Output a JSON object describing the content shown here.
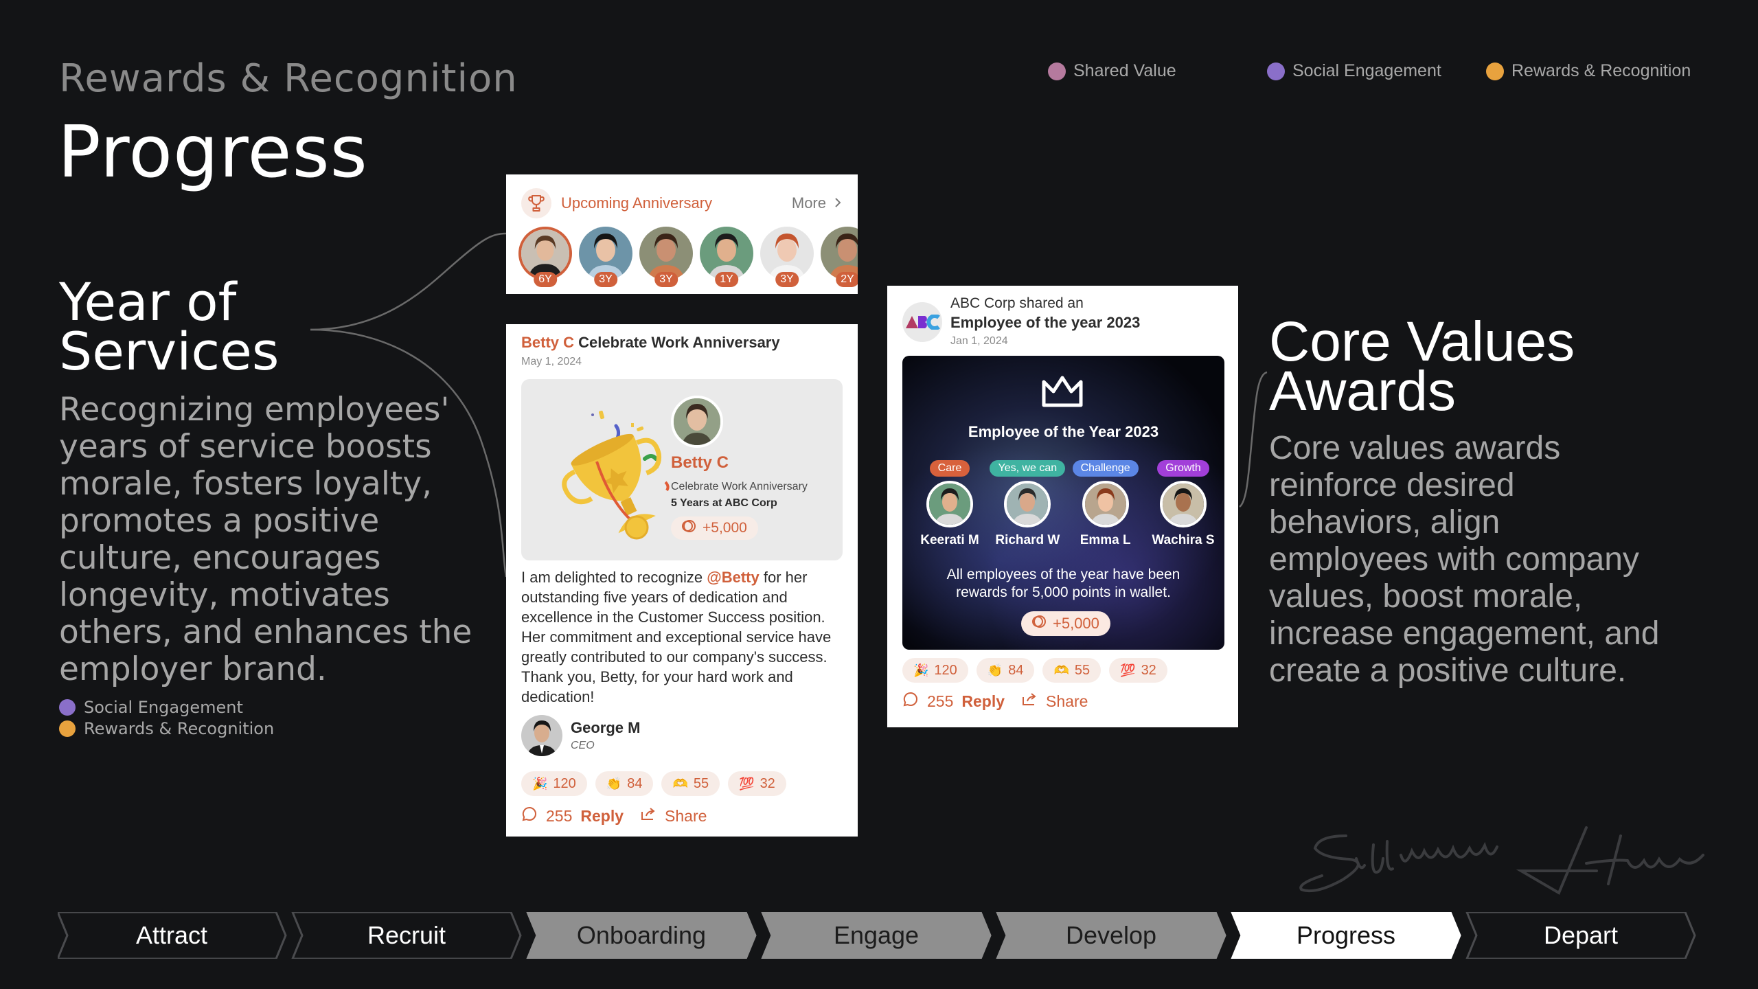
{
  "header": {
    "eyebrow": "Rewards & Recognition",
    "title": "Progress"
  },
  "top_legend": [
    {
      "label": "Shared Value",
      "color": "#b57a9e"
    },
    {
      "label": "Social Engagement",
      "color": "#8a6fc9"
    },
    {
      "label": "Rewards & Recognition",
      "color": "#e8a23e"
    }
  ],
  "left_section": {
    "title_line1": "Year of",
    "title_line2": "Services",
    "body_lines": [
      "Recognizing employees'",
      "years of service boosts",
      "morale, fosters loyalty,",
      "promotes a positive",
      "culture, encourages",
      "longevity, motivates",
      "others, and enhances the",
      "employer brand."
    ],
    "legend": [
      {
        "label": "Social Engagement",
        "color": "#8a6fc9"
      },
      {
        "label": "Rewards & Recognition",
        "color": "#e8a23e"
      }
    ]
  },
  "right_section": {
    "title_line1": "Core Values",
    "title_line2": "Awards",
    "body_lines": [
      "Core values awards",
      "reinforce desired",
      "behaviors, align",
      "employees with company",
      "values, boost morale,",
      "increase engagement, and",
      "create a positive culture."
    ]
  },
  "anniversary_card": {
    "title": "Upcoming Anniversary",
    "more_label": "More",
    "icon": "trophy-icon",
    "people": [
      {
        "years": "6Y",
        "bg": "#c9bfb3",
        "skin": "#e2b99b",
        "hair": "#5a3a24",
        "shirt": "#1e1e1e"
      },
      {
        "years": "3Y",
        "bg": "#6d94a8",
        "skin": "#e9c2a6",
        "hair": "#151515",
        "shirt": "#b9cfe0"
      },
      {
        "years": "3Y",
        "bg": "#8c8f76",
        "skin": "#c99072",
        "hair": "#3a2417",
        "shirt": "#d07b4e"
      },
      {
        "years": "1Y",
        "bg": "#6b9c7d",
        "skin": "#e0b08d",
        "hair": "#1c1c1c",
        "shirt": "#d7d7d7"
      },
      {
        "years": "3Y",
        "bg": "#e5e5e5",
        "skin": "#efc9b3",
        "hair": "#c4552e",
        "shirt": "#f4f4f4"
      },
      {
        "years": "2Y",
        "bg": "#8c8f76",
        "skin": "#c99072",
        "hair": "#3a2417",
        "shirt": "#d07b4e"
      }
    ]
  },
  "anniversary_post": {
    "name": "Betty C",
    "action": "Celebrate Work Anniversary",
    "date": "May 1, 2024",
    "hero": {
      "name": "Betty C",
      "subtitle": "Celebrate Work Anniversary",
      "tenure": "5 Years at ABC Corp",
      "points": "+5,000"
    },
    "message_prefix": "I am delighted to recognize ",
    "mention": "@Betty",
    "message_suffix": " for her outstanding five years of dedication and excellence in the Customer Success position. Her commitment and exceptional service have greatly contributed to our company's success. Thank you, Betty, for your hard work and dedication!",
    "author": {
      "name": "George M",
      "role": "CEO"
    },
    "reactions": [
      {
        "emoji": "🎉",
        "count": "120"
      },
      {
        "emoji": "👏",
        "count": "84"
      },
      {
        "emoji": "🫶",
        "count": "55"
      },
      {
        "emoji": "💯",
        "count": "32"
      }
    ],
    "comments": "255",
    "reply_label": "Reply",
    "share_label": "Share"
  },
  "core_values_post": {
    "company_logo": "ABC",
    "line1": "ABC Corp shared an",
    "line2": "Employee of the year 2023",
    "date": "Jan 1, 2024",
    "banner_title": "Employee of the Year 2023",
    "winners": [
      {
        "tag": "Care",
        "tag_color": "#d8613c",
        "name": "Keerati M",
        "bg": "#6b9c7d",
        "skin": "#e0b08d",
        "hair": "#1c1c1c"
      },
      {
        "tag": "Yes, we can",
        "tag_color": "#3fb3a1",
        "name": "Richard W",
        "bg": "#9fb3b3",
        "skin": "#d9a88a",
        "hair": "#2a2a2a"
      },
      {
        "tag": "Challenge",
        "tag_color": "#5b86e5",
        "name": "Emma L",
        "bg": "#b8a58e",
        "skin": "#efc2a3",
        "hair": "#8a3a1c"
      },
      {
        "tag": "Growth",
        "tag_color": "#a23fd9",
        "name": "Wachira S",
        "bg": "#c8bea8",
        "skin": "#a9724f",
        "hair": "#161616"
      }
    ],
    "banner_text_line1": "All employees of the year have been",
    "banner_text_line2": "rewards for 5,000 points in wallet.",
    "points": "+5,000",
    "reactions": [
      {
        "emoji": "🎉",
        "count": "120"
      },
      {
        "emoji": "👏",
        "count": "84"
      },
      {
        "emoji": "🫶",
        "count": "55"
      },
      {
        "emoji": "💯",
        "count": "32"
      }
    ],
    "comments": "255",
    "reply_label": "Reply",
    "share_label": "Share"
  },
  "signature": "Sittiporng Hans",
  "journey_nav": [
    {
      "label": "Attract",
      "state": "outline"
    },
    {
      "label": "Recruit",
      "state": "outline"
    },
    {
      "label": "Onboarding",
      "state": "gray"
    },
    {
      "label": "Engage",
      "state": "gray"
    },
    {
      "label": "Develop",
      "state": "gray"
    },
    {
      "label": "Progress",
      "state": "active"
    },
    {
      "label": "Depart",
      "state": "outline"
    }
  ]
}
